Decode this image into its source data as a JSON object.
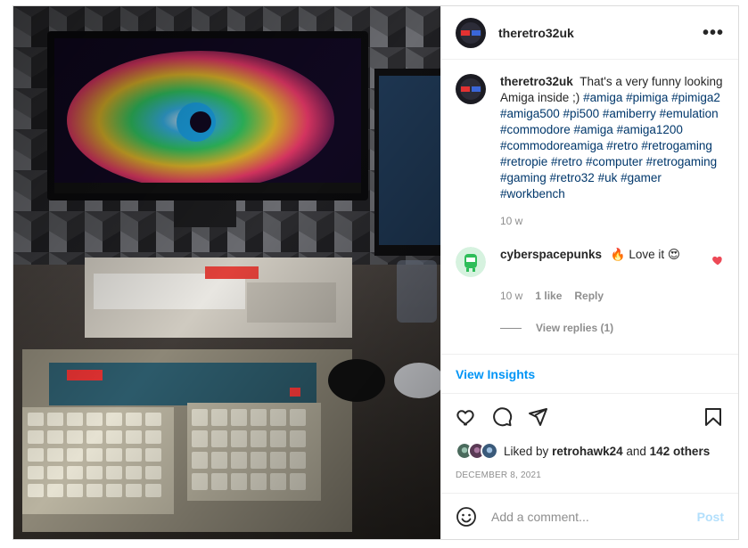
{
  "post": {
    "username": "theretro32uk",
    "more_label": "•••",
    "image_alt": "Retro32 Amiga setup with monitor, keyboards and mouse"
  },
  "caption": {
    "username": "theretro32uk",
    "text": "That's a very funny looking Amiga inside ;)",
    "tags": "#amiga #pimiga #pimiga2 #amiga500 #pi500 #amiberry #emulation #commodore #amiga #amiga1200 #commodoreamiga #retro #retrogaming #retropie #retro #computer #retrogaming #gaming #retro32 #uk #gamer #workbench",
    "time": "10 w"
  },
  "comment": {
    "username": "cyberspacepunks",
    "text": "🔥 Love it 😍",
    "time": "10 w",
    "likes": "1 like",
    "reply_label": "Reply",
    "view_replies": "View replies (1)"
  },
  "insights_label": "View Insights",
  "likes": {
    "prefix": "Liked by",
    "user": "retrohawk24",
    "joiner": "and",
    "others": "142 others"
  },
  "date": "DECEMBER 8, 2021",
  "add_comment": {
    "placeholder": "Add a comment...",
    "post_label": "Post"
  },
  "colors": {
    "link": "#00376b",
    "accent": "#0095f6",
    "post_disabled": "#b2dffc",
    "like_red": "#ed4956",
    "muted": "#8e8e8e"
  },
  "icons": {
    "like": "heart-icon",
    "comment": "comment-icon",
    "share": "share-icon",
    "save": "bookmark-icon",
    "emoji": "emoji-icon",
    "more": "more-horizontal-icon"
  }
}
